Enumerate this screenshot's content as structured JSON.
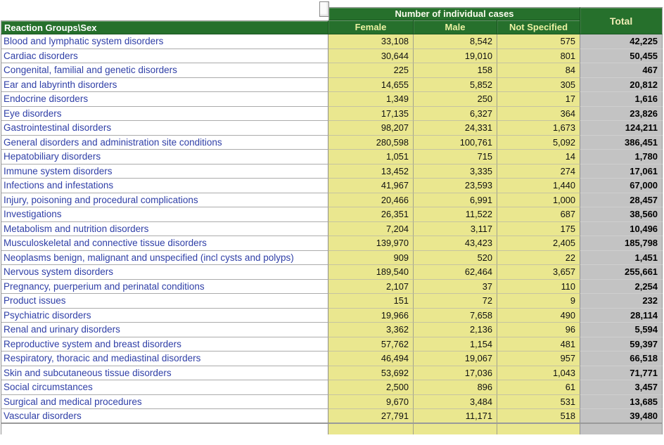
{
  "chart_data": {
    "type": "table",
    "corner_header": "Reaction Groups\\Sex",
    "group_header": "Number of individual cases",
    "total_header": "Total",
    "sex_columns": [
      "Female",
      "Male",
      "Not Specified"
    ],
    "rows": [
      {
        "label": "Blood and lymphatic system disorders",
        "female": "33,108",
        "male": "8,542",
        "not_specified": "575",
        "total": "42,225"
      },
      {
        "label": "Cardiac disorders",
        "female": "30,644",
        "male": "19,010",
        "not_specified": "801",
        "total": "50,455"
      },
      {
        "label": "Congenital, familial and genetic disorders",
        "female": "225",
        "male": "158",
        "not_specified": "84",
        "total": "467"
      },
      {
        "label": "Ear and labyrinth disorders",
        "female": "14,655",
        "male": "5,852",
        "not_specified": "305",
        "total": "20,812"
      },
      {
        "label": "Endocrine disorders",
        "female": "1,349",
        "male": "250",
        "not_specified": "17",
        "total": "1,616"
      },
      {
        "label": "Eye disorders",
        "female": "17,135",
        "male": "6,327",
        "not_specified": "364",
        "total": "23,826"
      },
      {
        "label": "Gastrointestinal disorders",
        "female": "98,207",
        "male": "24,331",
        "not_specified": "1,673",
        "total": "124,211"
      },
      {
        "label": "General disorders and administration site conditions",
        "female": "280,598",
        "male": "100,761",
        "not_specified": "5,092",
        "total": "386,451"
      },
      {
        "label": "Hepatobiliary disorders",
        "female": "1,051",
        "male": "715",
        "not_specified": "14",
        "total": "1,780"
      },
      {
        "label": "Immune system disorders",
        "female": "13,452",
        "male": "3,335",
        "not_specified": "274",
        "total": "17,061"
      },
      {
        "label": "Infections and infestations",
        "female": "41,967",
        "male": "23,593",
        "not_specified": "1,440",
        "total": "67,000"
      },
      {
        "label": "Injury, poisoning and procedural complications",
        "female": "20,466",
        "male": "6,991",
        "not_specified": "1,000",
        "total": "28,457"
      },
      {
        "label": "Investigations",
        "female": "26,351",
        "male": "11,522",
        "not_specified": "687",
        "total": "38,560"
      },
      {
        "label": "Metabolism and nutrition disorders",
        "female": "7,204",
        "male": "3,117",
        "not_specified": "175",
        "total": "10,496"
      },
      {
        "label": "Musculoskeletal and connective tissue disorders",
        "female": "139,970",
        "male": "43,423",
        "not_specified": "2,405",
        "total": "185,798"
      },
      {
        "label": "Neoplasms benign, malignant and unspecified (incl cysts and polyps)",
        "female": "909",
        "male": "520",
        "not_specified": "22",
        "total": "1,451"
      },
      {
        "label": "Nervous system disorders",
        "female": "189,540",
        "male": "62,464",
        "not_specified": "3,657",
        "total": "255,661"
      },
      {
        "label": "Pregnancy, puerperium and perinatal conditions",
        "female": "2,107",
        "male": "37",
        "not_specified": "110",
        "total": "2,254"
      },
      {
        "label": "Product issues",
        "female": "151",
        "male": "72",
        "not_specified": "9",
        "total": "232"
      },
      {
        "label": "Psychiatric disorders",
        "female": "19,966",
        "male": "7,658",
        "not_specified": "490",
        "total": "28,114"
      },
      {
        "label": "Renal and urinary disorders",
        "female": "3,362",
        "male": "2,136",
        "not_specified": "96",
        "total": "5,594"
      },
      {
        "label": "Reproductive system and breast disorders",
        "female": "57,762",
        "male": "1,154",
        "not_specified": "481",
        "total": "59,397"
      },
      {
        "label": "Respiratory, thoracic and mediastinal disorders",
        "female": "46,494",
        "male": "19,067",
        "not_specified": "957",
        "total": "66,518"
      },
      {
        "label": "Skin and subcutaneous tissue disorders",
        "female": "53,692",
        "male": "17,036",
        "not_specified": "1,043",
        "total": "71,771"
      },
      {
        "label": "Social circumstances",
        "female": "2,500",
        "male": "896",
        "not_specified": "61",
        "total": "3,457"
      },
      {
        "label": "Surgical and medical procedures",
        "female": "9,670",
        "male": "3,484",
        "not_specified": "531",
        "total": "13,685"
      },
      {
        "label": "Vascular disorders",
        "female": "27,791",
        "male": "11,171",
        "not_specified": "518",
        "total": "39,480"
      }
    ]
  },
  "colors": {
    "header_green": "#26702C",
    "header_text_pale_yellow": "#ECF1A3",
    "header_text_white": "#FFFFFF",
    "data_cell_yellow": "#EAE78F",
    "total_column_gray": "#C3C3C3",
    "row_label_blue": "#2F3FA7"
  }
}
